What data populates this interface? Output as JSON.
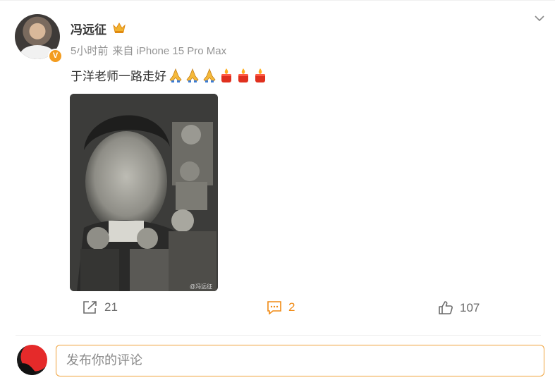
{
  "post": {
    "username": "冯远征",
    "time": "5小时前",
    "source": "来自 iPhone 15 Pro Max",
    "text": "于洋老师一路走好",
    "emojis": [
      "folded-hands",
      "folded-hands",
      "folded-hands",
      "candle",
      "candle",
      "candle"
    ],
    "photo_watermark": "@冯远征"
  },
  "actions": {
    "repost_count": "21",
    "comment_count": "2",
    "like_count": "107"
  },
  "comment_input": {
    "placeholder": "发布你的评论"
  },
  "colors": {
    "accent": "#f08a14",
    "vip_badge": "#f39c1f",
    "meta_gray": "#939393"
  }
}
